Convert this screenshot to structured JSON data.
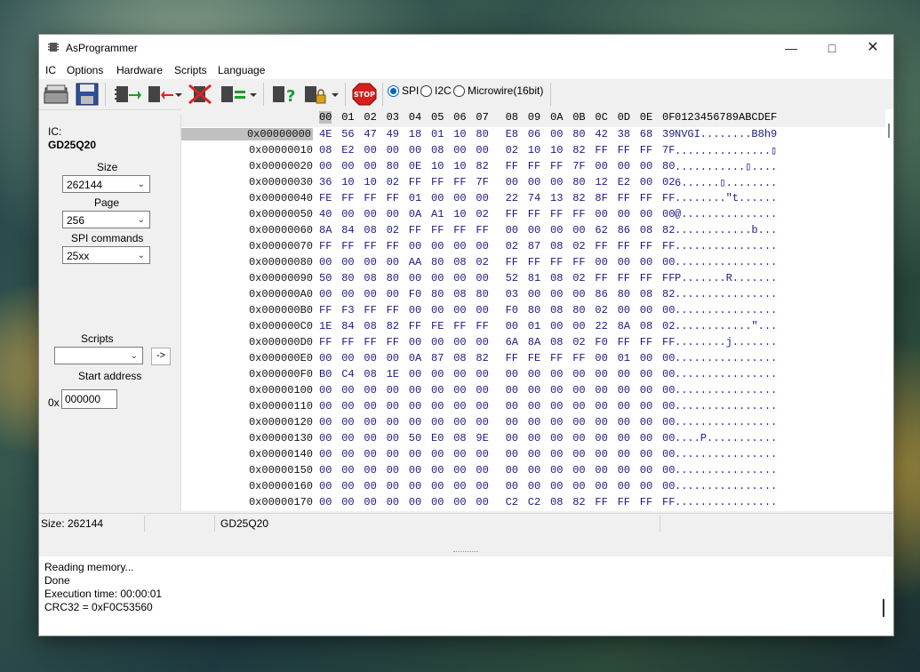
{
  "window": {
    "title": "AsProgrammer"
  },
  "menu": [
    "IC",
    "Options",
    "Hardware",
    "Scripts",
    "Language"
  ],
  "toolbar": {
    "stop_label": "STOP",
    "protocols": [
      "SPI",
      "I2C",
      "Microwire(16bit)"
    ],
    "selected_protocol": "SPI"
  },
  "left_panel": {
    "ic_label": "IC:",
    "ic_name": "GD25Q20",
    "size_label": "Size",
    "size_value": "262144",
    "page_label": "Page",
    "page_value": "256",
    "spi_label": "SPI commands",
    "spi_value": "25xx",
    "scripts_label": "Scripts",
    "scripts_value": "",
    "run_button": "->",
    "start_label": "Start address",
    "start_prefix": "0x",
    "start_value": "000000"
  },
  "hex": {
    "columns": [
      "00",
      "01",
      "02",
      "03",
      "04",
      "05",
      "06",
      "07",
      "08",
      "09",
      "0A",
      "0B",
      "0C",
      "0D",
      "0E",
      "0F"
    ],
    "ascii_header": "0123456789ABCDEF",
    "rows": [
      {
        "addr": "0x00000000",
        "bytes": [
          "4E",
          "56",
          "47",
          "49",
          "18",
          "01",
          "10",
          "80",
          "E8",
          "06",
          "00",
          "80",
          "42",
          "38",
          "68",
          "39"
        ],
        "ascii": "NVGI........B8h9"
      },
      {
        "addr": "0x00000010",
        "bytes": [
          "08",
          "E2",
          "00",
          "00",
          "00",
          "08",
          "00",
          "00",
          "02",
          "10",
          "10",
          "82",
          "FF",
          "FF",
          "FF",
          "7F"
        ],
        "ascii": "...............▯"
      },
      {
        "addr": "0x00000020",
        "bytes": [
          "00",
          "00",
          "00",
          "80",
          "0E",
          "10",
          "10",
          "82",
          "FF",
          "FF",
          "FF",
          "7F",
          "00",
          "00",
          "00",
          "80"
        ],
        "ascii": "...........▯...."
      },
      {
        "addr": "0x00000030",
        "bytes": [
          "36",
          "10",
          "10",
          "02",
          "FF",
          "FF",
          "FF",
          "7F",
          "00",
          "00",
          "00",
          "80",
          "12",
          "E2",
          "00",
          "02"
        ],
        "ascii": "6......▯........"
      },
      {
        "addr": "0x00000040",
        "bytes": [
          "FE",
          "FF",
          "FF",
          "FF",
          "01",
          "00",
          "00",
          "00",
          "22",
          "74",
          "13",
          "82",
          "8F",
          "FF",
          "FF",
          "FF"
        ],
        "ascii": "........\"t......"
      },
      {
        "addr": "0x00000050",
        "bytes": [
          "40",
          "00",
          "00",
          "00",
          "0A",
          "A1",
          "10",
          "02",
          "FF",
          "FF",
          "FF",
          "FF",
          "00",
          "00",
          "00",
          "00"
        ],
        "ascii": "@..............."
      },
      {
        "addr": "0x00000060",
        "bytes": [
          "8A",
          "84",
          "08",
          "02",
          "FF",
          "FF",
          "FF",
          "FF",
          "00",
          "00",
          "00",
          "00",
          "62",
          "86",
          "08",
          "82"
        ],
        "ascii": "............b..."
      },
      {
        "addr": "0x00000070",
        "bytes": [
          "FF",
          "FF",
          "FF",
          "FF",
          "00",
          "00",
          "00",
          "00",
          "02",
          "87",
          "08",
          "02",
          "FF",
          "FF",
          "FF",
          "FF"
        ],
        "ascii": "................"
      },
      {
        "addr": "0x00000080",
        "bytes": [
          "00",
          "00",
          "00",
          "00",
          "AA",
          "80",
          "08",
          "02",
          "FF",
          "FF",
          "FF",
          "FF",
          "00",
          "00",
          "00",
          "00"
        ],
        "ascii": "................"
      },
      {
        "addr": "0x00000090",
        "bytes": [
          "50",
          "80",
          "08",
          "80",
          "00",
          "00",
          "00",
          "00",
          "52",
          "81",
          "08",
          "02",
          "FF",
          "FF",
          "FF",
          "FF"
        ],
        "ascii": "P.......R......."
      },
      {
        "addr": "0x000000A0",
        "bytes": [
          "00",
          "00",
          "00",
          "00",
          "F0",
          "80",
          "08",
          "80",
          "03",
          "00",
          "00",
          "00",
          "86",
          "80",
          "08",
          "82"
        ],
        "ascii": "................"
      },
      {
        "addr": "0x000000B0",
        "bytes": [
          "FF",
          "F3",
          "FF",
          "FF",
          "00",
          "00",
          "00",
          "00",
          "F0",
          "80",
          "08",
          "80",
          "02",
          "00",
          "00",
          "00"
        ],
        "ascii": "................"
      },
      {
        "addr": "0x000000C0",
        "bytes": [
          "1E",
          "84",
          "08",
          "82",
          "FF",
          "FE",
          "FF",
          "FF",
          "00",
          "01",
          "00",
          "00",
          "22",
          "8A",
          "08",
          "02"
        ],
        "ascii": "............\"..."
      },
      {
        "addr": "0x000000D0",
        "bytes": [
          "FF",
          "FF",
          "FF",
          "FF",
          "00",
          "00",
          "00",
          "00",
          "6A",
          "8A",
          "08",
          "02",
          "F0",
          "FF",
          "FF",
          "FF"
        ],
        "ascii": "........j......."
      },
      {
        "addr": "0x000000E0",
        "bytes": [
          "00",
          "00",
          "00",
          "00",
          "0A",
          "87",
          "08",
          "82",
          "FF",
          "FE",
          "FF",
          "FF",
          "00",
          "01",
          "00",
          "00"
        ],
        "ascii": "................"
      },
      {
        "addr": "0x000000F0",
        "bytes": [
          "B0",
          "C4",
          "08",
          "1E",
          "00",
          "00",
          "00",
          "00",
          "00",
          "00",
          "00",
          "00",
          "00",
          "00",
          "00",
          "00"
        ],
        "ascii": "................"
      },
      {
        "addr": "0x00000100",
        "bytes": [
          "00",
          "00",
          "00",
          "00",
          "00",
          "00",
          "00",
          "00",
          "00",
          "00",
          "00",
          "00",
          "00",
          "00",
          "00",
          "00"
        ],
        "ascii": "................"
      },
      {
        "addr": "0x00000110",
        "bytes": [
          "00",
          "00",
          "00",
          "00",
          "00",
          "00",
          "00",
          "00",
          "00",
          "00",
          "00",
          "00",
          "00",
          "00",
          "00",
          "00"
        ],
        "ascii": "................"
      },
      {
        "addr": "0x00000120",
        "bytes": [
          "00",
          "00",
          "00",
          "00",
          "00",
          "00",
          "00",
          "00",
          "00",
          "00",
          "00",
          "00",
          "00",
          "00",
          "00",
          "00"
        ],
        "ascii": "................"
      },
      {
        "addr": "0x00000130",
        "bytes": [
          "00",
          "00",
          "00",
          "00",
          "50",
          "E0",
          "08",
          "9E",
          "00",
          "00",
          "00",
          "00",
          "00",
          "00",
          "00",
          "00"
        ],
        "ascii": "....P..........."
      },
      {
        "addr": "0x00000140",
        "bytes": [
          "00",
          "00",
          "00",
          "00",
          "00",
          "00",
          "00",
          "00",
          "00",
          "00",
          "00",
          "00",
          "00",
          "00",
          "00",
          "00"
        ],
        "ascii": "................"
      },
      {
        "addr": "0x00000150",
        "bytes": [
          "00",
          "00",
          "00",
          "00",
          "00",
          "00",
          "00",
          "00",
          "00",
          "00",
          "00",
          "00",
          "00",
          "00",
          "00",
          "00"
        ],
        "ascii": "................"
      },
      {
        "addr": "0x00000160",
        "bytes": [
          "00",
          "00",
          "00",
          "00",
          "00",
          "00",
          "00",
          "00",
          "00",
          "00",
          "00",
          "00",
          "00",
          "00",
          "00",
          "00"
        ],
        "ascii": "................"
      },
      {
        "addr": "0x00000170",
        "bytes": [
          "00",
          "00",
          "00",
          "00",
          "00",
          "00",
          "00",
          "00",
          "C2",
          "C2",
          "08",
          "82",
          "FF",
          "FF",
          "FF",
          "FF"
        ],
        "ascii": "................"
      }
    ]
  },
  "status": {
    "size": "Size: 262144",
    "ic": "GD25Q20"
  },
  "log": [
    "Reading memory...",
    "Done",
    "Execution time: 00:00:01",
    "CRC32 = 0xF0C53560"
  ]
}
